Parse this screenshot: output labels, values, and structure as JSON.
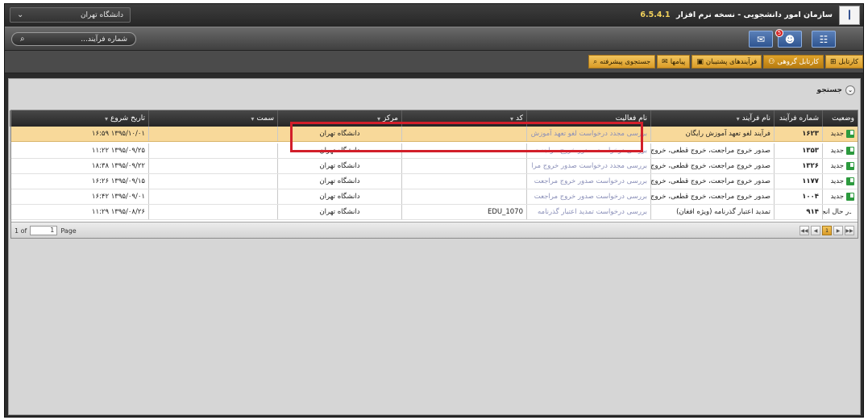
{
  "header": {
    "app_title": "سازمان امور دانشجویی  -  نسخه نرم افزار",
    "version": "6.5.4.1",
    "org_select_value": "دانشگاه تهران",
    "logo_text": "ا"
  },
  "toolbar": {
    "search_placeholder": "شماره فرآیند...",
    "badge_count": "5"
  },
  "tabs": [
    {
      "label": "کارتابل",
      "icon": "sitemap-icon"
    },
    {
      "label": "کارتابل گروهی",
      "icon": "users-icon"
    },
    {
      "label": "فرآیندهای پشتیبان",
      "icon": "box-icon"
    },
    {
      "label": "پیامها",
      "icon": "mail-icon"
    },
    {
      "label": "جستجوی پیشرفته",
      "icon": "search-icon"
    }
  ],
  "section": {
    "title": "جستجو"
  },
  "grid": {
    "columns": [
      "وضعیت",
      "شماره فرآیند",
      "نام فرآیند",
      "نام فعالیت",
      "کد",
      "مرکز",
      "سمت",
      "تاریخ شروع"
    ],
    "rows": [
      {
        "status": "جدید",
        "number": "۱۶۲۳",
        "process": "فرآیند لغو تعهد آموزش رایگان",
        "activity": "بررسی مجدد درخواست لغو تعهد آموزش",
        "code": "",
        "center": "دانشگاه تهران",
        "role": "",
        "date": "۱۳۹۵/۱۰/۰۱ ۱۶:۵۹"
      },
      {
        "status": "جدید",
        "number": "۱۳۵۳",
        "process": "صدور خروج مراجعت، خروج قطعی، خروج",
        "activity": "بررسی درخواست صدور خروج مراجعت",
        "code": "",
        "center": "دانشگاه تهران",
        "role": "",
        "date": "۱۳۹۵/۰۹/۲۵ ۱۱:۲۲"
      },
      {
        "status": "جدید",
        "number": "۱۳۲۶",
        "process": "صدور خروج مراجعت، خروج قطعی، خروج",
        "activity": "بررسی مجدد درخواست صدور خروج مرا",
        "code": "",
        "center": "دانشگاه تهران",
        "role": "",
        "date": "۱۳۹۵/۰۹/۲۲ ۱۸:۳۸"
      },
      {
        "status": "جدید",
        "number": "۱۱۷۷",
        "process": "صدور خروج مراجعت، خروج قطعی، خروج",
        "activity": "بررسی درخواست صدور خروج مراجعت",
        "code": "",
        "center": "دانشگاه تهران",
        "role": "",
        "date": "۱۳۹۵/۰۹/۱۵ ۱۶:۲۶"
      },
      {
        "status": "جدید",
        "number": "۱۰۰۴",
        "process": "صدور خروج مراجعت، خروج قطعی، خروج",
        "activity": "بررسی درخواست صدور خروج مراجعت",
        "code": "",
        "center": "دانشگاه تهران",
        "role": "",
        "date": "۱۳۹۵/۰۹/۰۱ ۱۶:۴۲"
      },
      {
        "status": "در حال انجام",
        "number": "۹۱۴",
        "process": "تمدید اعتبار گذرنامه (ویژه افغان)",
        "activity": "بررسی درخواست تمدید اعتبار گذرنامه",
        "code": "EDU_1070",
        "center": "دانشگاه تهران",
        "role": "",
        "date": "۱۳۹۵/۰۸/۲۶ ۱۱:۲۹"
      }
    ]
  },
  "pager": {
    "of_label": "1 of",
    "page_value": "1",
    "page_label": "Page",
    "current_page": "1"
  },
  "colors": {
    "accent_gold": "#e0a32a",
    "selected_row": "#f8d99a",
    "highlight_box": "#d21f2a"
  }
}
